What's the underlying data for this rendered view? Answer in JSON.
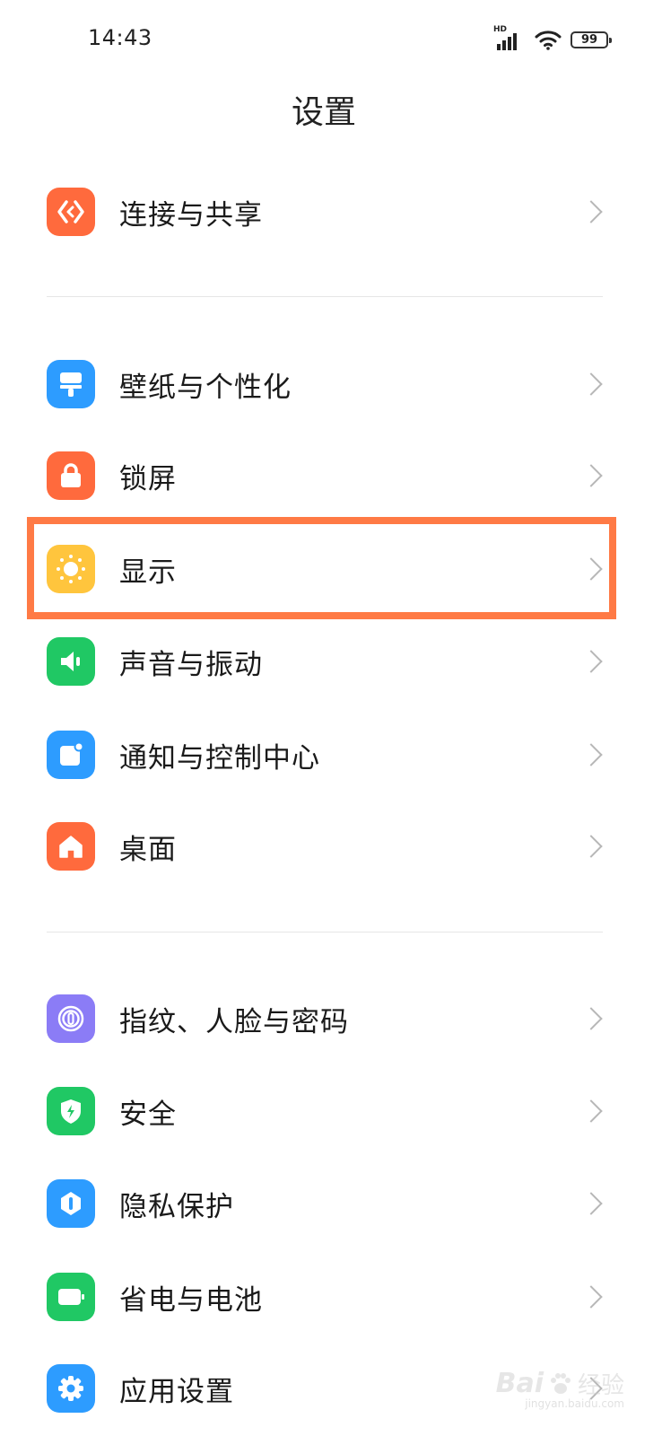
{
  "status_bar": {
    "time": "14:43",
    "network_badge": "HD",
    "battery_level": "99",
    "icons": [
      "signal-icon",
      "wifi-icon",
      "battery-icon"
    ]
  },
  "header": {
    "title": "设置"
  },
  "settings": [
    {
      "label": "连接与共享",
      "icon": "connection-share-icon",
      "color": "#ff6a3d"
    },
    {
      "label": "壁纸与个性化",
      "icon": "wallpaper-icon",
      "color": "#2d9cff"
    },
    {
      "label": "锁屏",
      "icon": "lock-icon",
      "color": "#ff6a3d"
    },
    {
      "label": "显示",
      "icon": "brightness-icon",
      "color": "#ffc53d",
      "highlighted": true
    },
    {
      "label": "声音与振动",
      "icon": "speaker-icon",
      "color": "#20c864"
    },
    {
      "label": "通知与控制中心",
      "icon": "notification-icon",
      "color": "#2d9cff"
    },
    {
      "label": "桌面",
      "icon": "home-icon",
      "color": "#ff6a3d"
    },
    {
      "label": "指纹、人脸与密码",
      "icon": "fingerprint-icon",
      "color": "#8b7cf6"
    },
    {
      "label": "安全",
      "icon": "shield-icon",
      "color": "#20c864"
    },
    {
      "label": "隐私保护",
      "icon": "privacy-icon",
      "color": "#2d9cff"
    },
    {
      "label": "省电与电池",
      "icon": "battery-saver-icon",
      "color": "#20c864"
    },
    {
      "label": "应用设置",
      "icon": "gear-icon",
      "color": "#2d9cff"
    }
  ],
  "highlight_color": "#ff7a45",
  "watermark": {
    "brand": "Bai",
    "suffix": "经验",
    "url": "jingyan.baidu.com"
  }
}
